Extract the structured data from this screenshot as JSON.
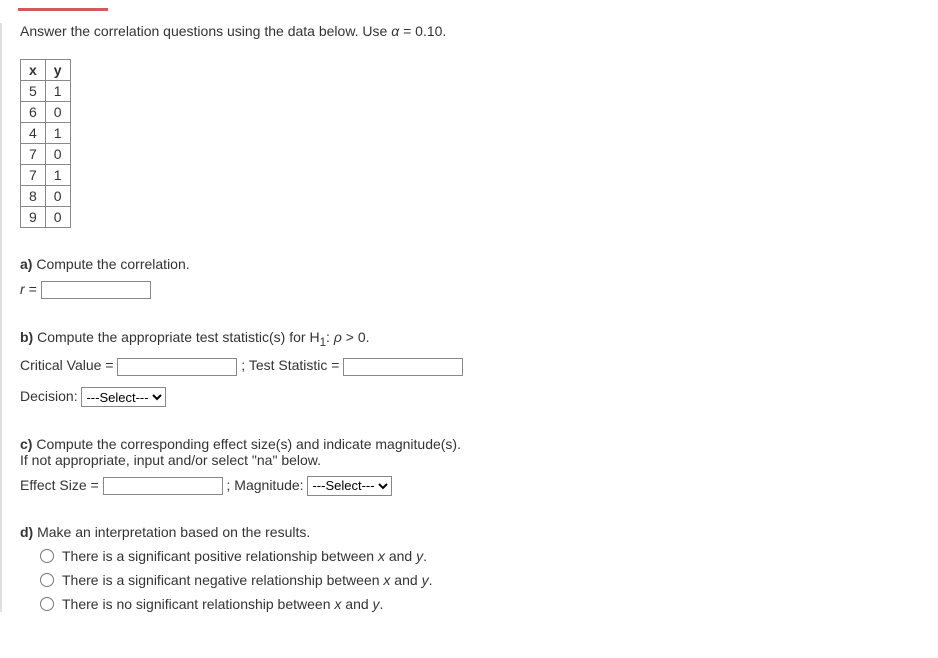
{
  "intro": {
    "prefix": "Answer the correlation questions using the data below. Use ",
    "alpha_var": "α",
    "alpha_eq": " = 0.10."
  },
  "table": {
    "headers": {
      "x": "x",
      "y": "y"
    },
    "rows": [
      {
        "x": "5",
        "y": "1"
      },
      {
        "x": "6",
        "y": "0"
      },
      {
        "x": "4",
        "y": "1"
      },
      {
        "x": "7",
        "y": "0"
      },
      {
        "x": "7",
        "y": "1"
      },
      {
        "x": "8",
        "y": "0"
      },
      {
        "x": "9",
        "y": "0"
      }
    ]
  },
  "a": {
    "label": "a)",
    "text": " Compute the correlation.",
    "r_label": "r = "
  },
  "b": {
    "label": "b)",
    "text_prefix": " Compute the appropriate test statistic(s) for H",
    "sub": "1",
    "text_mid": ": ",
    "rho": "ρ",
    "text_suffix": " > 0.",
    "critical_label": "Critical Value = ",
    "sep": " ;  ",
    "teststat_label": "Test Statistic = ",
    "decision_label": "Decision: ",
    "select_placeholder": "---Select---"
  },
  "c": {
    "label": "c)",
    "text": " Compute the corresponding effect size(s) and indicate magnitude(s).",
    "note": "If not appropriate, input and/or select \"na\" below.",
    "effect_label": "Effect Size = ",
    "sep": " ;  ",
    "magnitude_label": "Magnitude: ",
    "select_placeholder": "---Select---"
  },
  "d": {
    "label": "d)",
    "text": " Make an interpretation based on the results.",
    "opt1_pre": "There is a significant positive relationship between ",
    "opt1_x": "x",
    "opt1_mid": " and ",
    "opt1_y": "y",
    "opt1_suf": ".",
    "opt2_pre": "There is a significant negative relationship between ",
    "opt2_x": "x",
    "opt2_mid": " and ",
    "opt2_y": "y",
    "opt2_suf": ".",
    "opt3_pre": "There is no significant relationship between ",
    "opt3_x": "x",
    "opt3_mid": " and ",
    "opt3_y": "y",
    "opt3_suf": "."
  }
}
